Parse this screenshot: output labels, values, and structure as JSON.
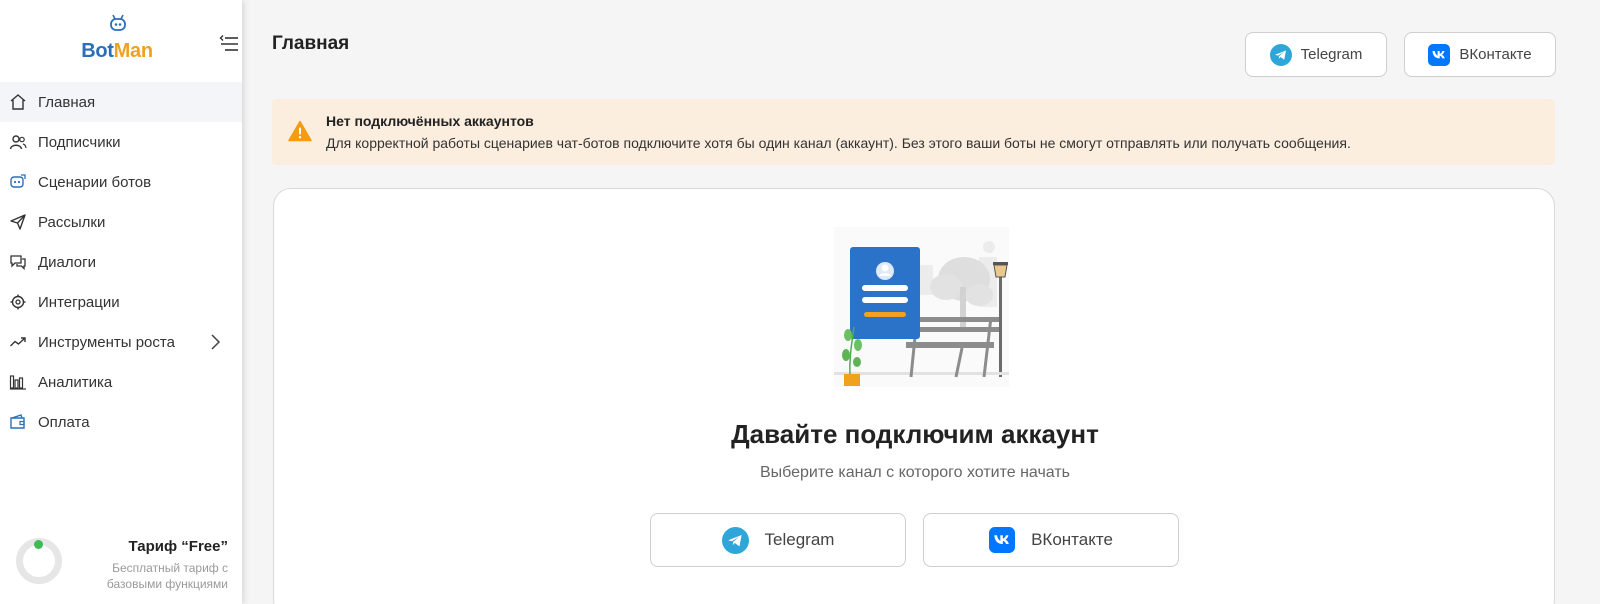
{
  "brand": {
    "name_part1": "Bot",
    "name_part2": "Man",
    "color_primary": "#2a6fb8",
    "color_accent": "#f0a21e"
  },
  "sidebar": {
    "items": [
      {
        "label": "Главная",
        "icon": "home-icon",
        "active": true
      },
      {
        "label": "Подписчики",
        "icon": "users-icon"
      },
      {
        "label": "Сценарии ботов",
        "icon": "bot-scenario-icon"
      },
      {
        "label": "Рассылки",
        "icon": "send-icon"
      },
      {
        "label": "Диалоги",
        "icon": "chat-icon"
      },
      {
        "label": "Интеграции",
        "icon": "integrations-icon"
      },
      {
        "label": "Инструменты роста",
        "icon": "growth-icon",
        "has_submenu": true
      },
      {
        "label": "Аналитика",
        "icon": "analytics-icon"
      },
      {
        "label": "Оплата",
        "icon": "wallet-icon"
      }
    ],
    "tariff": {
      "title": "Тариф “Free”",
      "description": "Бесплатный тариф с базовыми функциями"
    }
  },
  "header": {
    "title": "Главная",
    "telegram_label": "Telegram",
    "vk_label": "ВКонтакте"
  },
  "alert": {
    "title": "Нет подключённых аккаунтов",
    "text": "Для корректной работы сценариев чат-ботов подключите хотя бы один канал (аккаунт). Без этого ваши боты не смогут отправлять или получать сообщения.",
    "color": "#fbeede"
  },
  "card": {
    "title": "Давайте подключим аккаунт",
    "subtitle": "Выберите канал с которого хотите начать",
    "telegram_label": "Telegram",
    "vk_label": "ВКонтакте"
  },
  "colors": {
    "telegram": "#2ea6d9",
    "vk": "#0077ff",
    "warning": "#f39c12"
  }
}
